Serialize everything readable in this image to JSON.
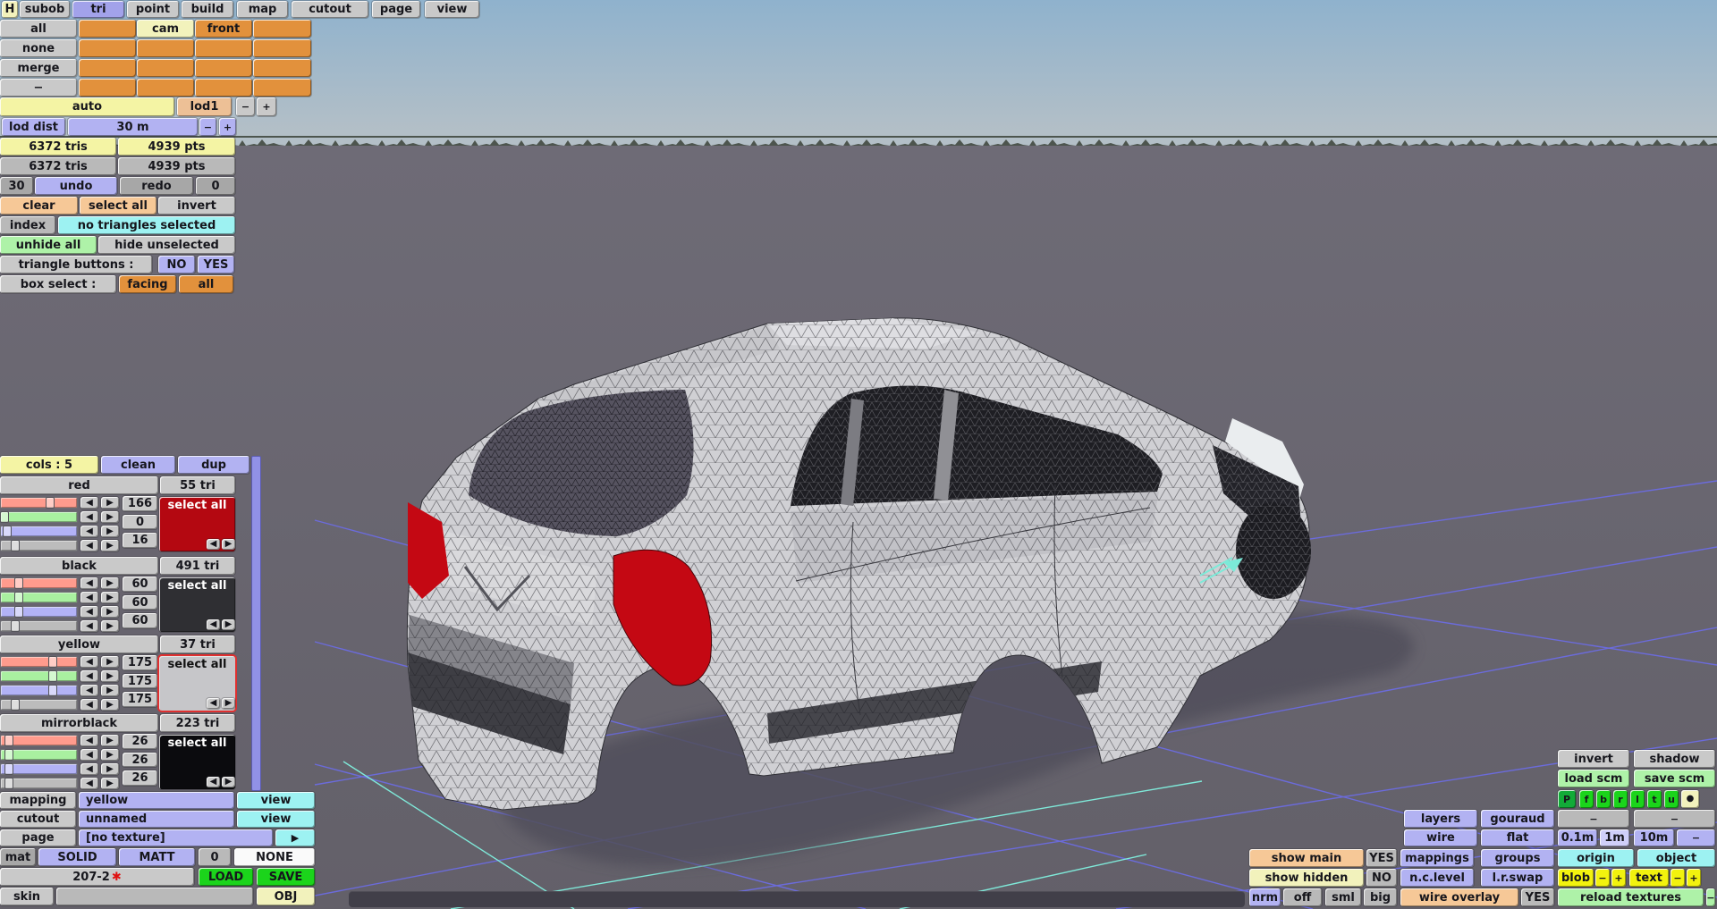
{
  "colors": {
    "accent_orange": "#e2913c",
    "accent_purple": "#b2b2f2",
    "accent_yellow": "#f4f4a4",
    "accent_cyan": "#9df2f2",
    "accent_green_bright": "#1bd41b",
    "grid_line": "#6c6ce2",
    "grid_line_alt": "#7fe9d9",
    "sky_top": "#8fb2cd",
    "ground": "#6a6772",
    "swatch_red": "#b40811",
    "swatch_black": "#2f2f33",
    "swatch_yellow": "#c6c6c9",
    "swatch_mirrorblack": "#0b0b0e"
  },
  "icons": {
    "arrow_left": "◀",
    "arrow_right": "▶",
    "arrow_play": "▶",
    "dot": "●",
    "star": "✱"
  },
  "common": {
    "minus": "−",
    "plus": "+",
    "dash": "−"
  },
  "menu": {
    "items": [
      "H",
      "subob",
      "tri",
      "point",
      "build",
      "map",
      "cutout",
      "page",
      "view"
    ]
  },
  "subob_grid": {
    "row_labels": [
      "all",
      "none",
      "merge",
      "−"
    ],
    "cam": "cam",
    "front": "front"
  },
  "lod": {
    "auto": "auto",
    "lod1": "lod1",
    "label": "lod dist",
    "value": "30 m"
  },
  "stats": {
    "tris": "6372 tris",
    "pts": "4939 pts"
  },
  "history": {
    "undo_count": "30",
    "undo": "undo",
    "redo": "redo",
    "redo_count": "0"
  },
  "selection": {
    "clear": "clear",
    "select_all": "select all",
    "invert": "invert",
    "index": "index",
    "status": "no triangles selected",
    "unhide_all": "unhide all",
    "hide_unselected": "hide unselected",
    "triangle_buttons": "triangle buttons :",
    "no": "NO",
    "yes": "YES",
    "box_select": "box select :",
    "facing": "facing",
    "all": "all"
  },
  "colors_panel": {
    "cols": "cols : 5",
    "clean": "clean",
    "dup": "dup",
    "select_all": "select all",
    "sections": [
      {
        "name": "red",
        "tri": "55 tri",
        "r": 166,
        "g": 0,
        "b": 16
      },
      {
        "name": "black",
        "tri": "491 tri",
        "r": 60,
        "g": 60,
        "b": 60
      },
      {
        "name": "yellow",
        "tri": "37 tri",
        "r": 175,
        "g": 175,
        "b": 175
      },
      {
        "name": "mirrorblack",
        "tri": "223 tri",
        "r": 26,
        "g": 26,
        "b": 26
      }
    ]
  },
  "material_panel": {
    "mapping": "mapping",
    "mapping_value": "yellow",
    "view": "view",
    "cutout": "cutout",
    "cutout_value": "unnamed",
    "page": "page",
    "page_value": "[no texture]",
    "mat": "mat",
    "solid": "SOLID",
    "matt": "MATT",
    "zero": "0",
    "none": "NONE",
    "model_name": "207-2",
    "load": "LOAD",
    "save": "SAVE",
    "skin": "skin",
    "obj": "OBJ"
  },
  "right_panel": {
    "invert": "invert",
    "shadow": "shadow",
    "load_scm": "load scm",
    "save_scm": "save scm",
    "proj": [
      "P",
      "f",
      "b",
      "r",
      "l",
      "t",
      "u"
    ],
    "layers": "layers",
    "gouraud": "gouraud",
    "wire": "wire",
    "flat": "flat",
    "d01": "0.1m",
    "d1": "1m",
    "d10": "10m",
    "show_main": "show main",
    "yes": "YES",
    "mappings": "mappings",
    "groups": "groups",
    "origin": "origin",
    "object": "object",
    "show_hidden": "show hidden",
    "no": "NO",
    "nclevel": "n.c.level",
    "lrswap": "l.r.swap",
    "blob": "blob",
    "text": "text",
    "nrm": "nrm",
    "off": "off",
    "sml": "sml",
    "big": "big",
    "wire_overlay": "wire overlay",
    "reload_textures": "reload textures"
  }
}
